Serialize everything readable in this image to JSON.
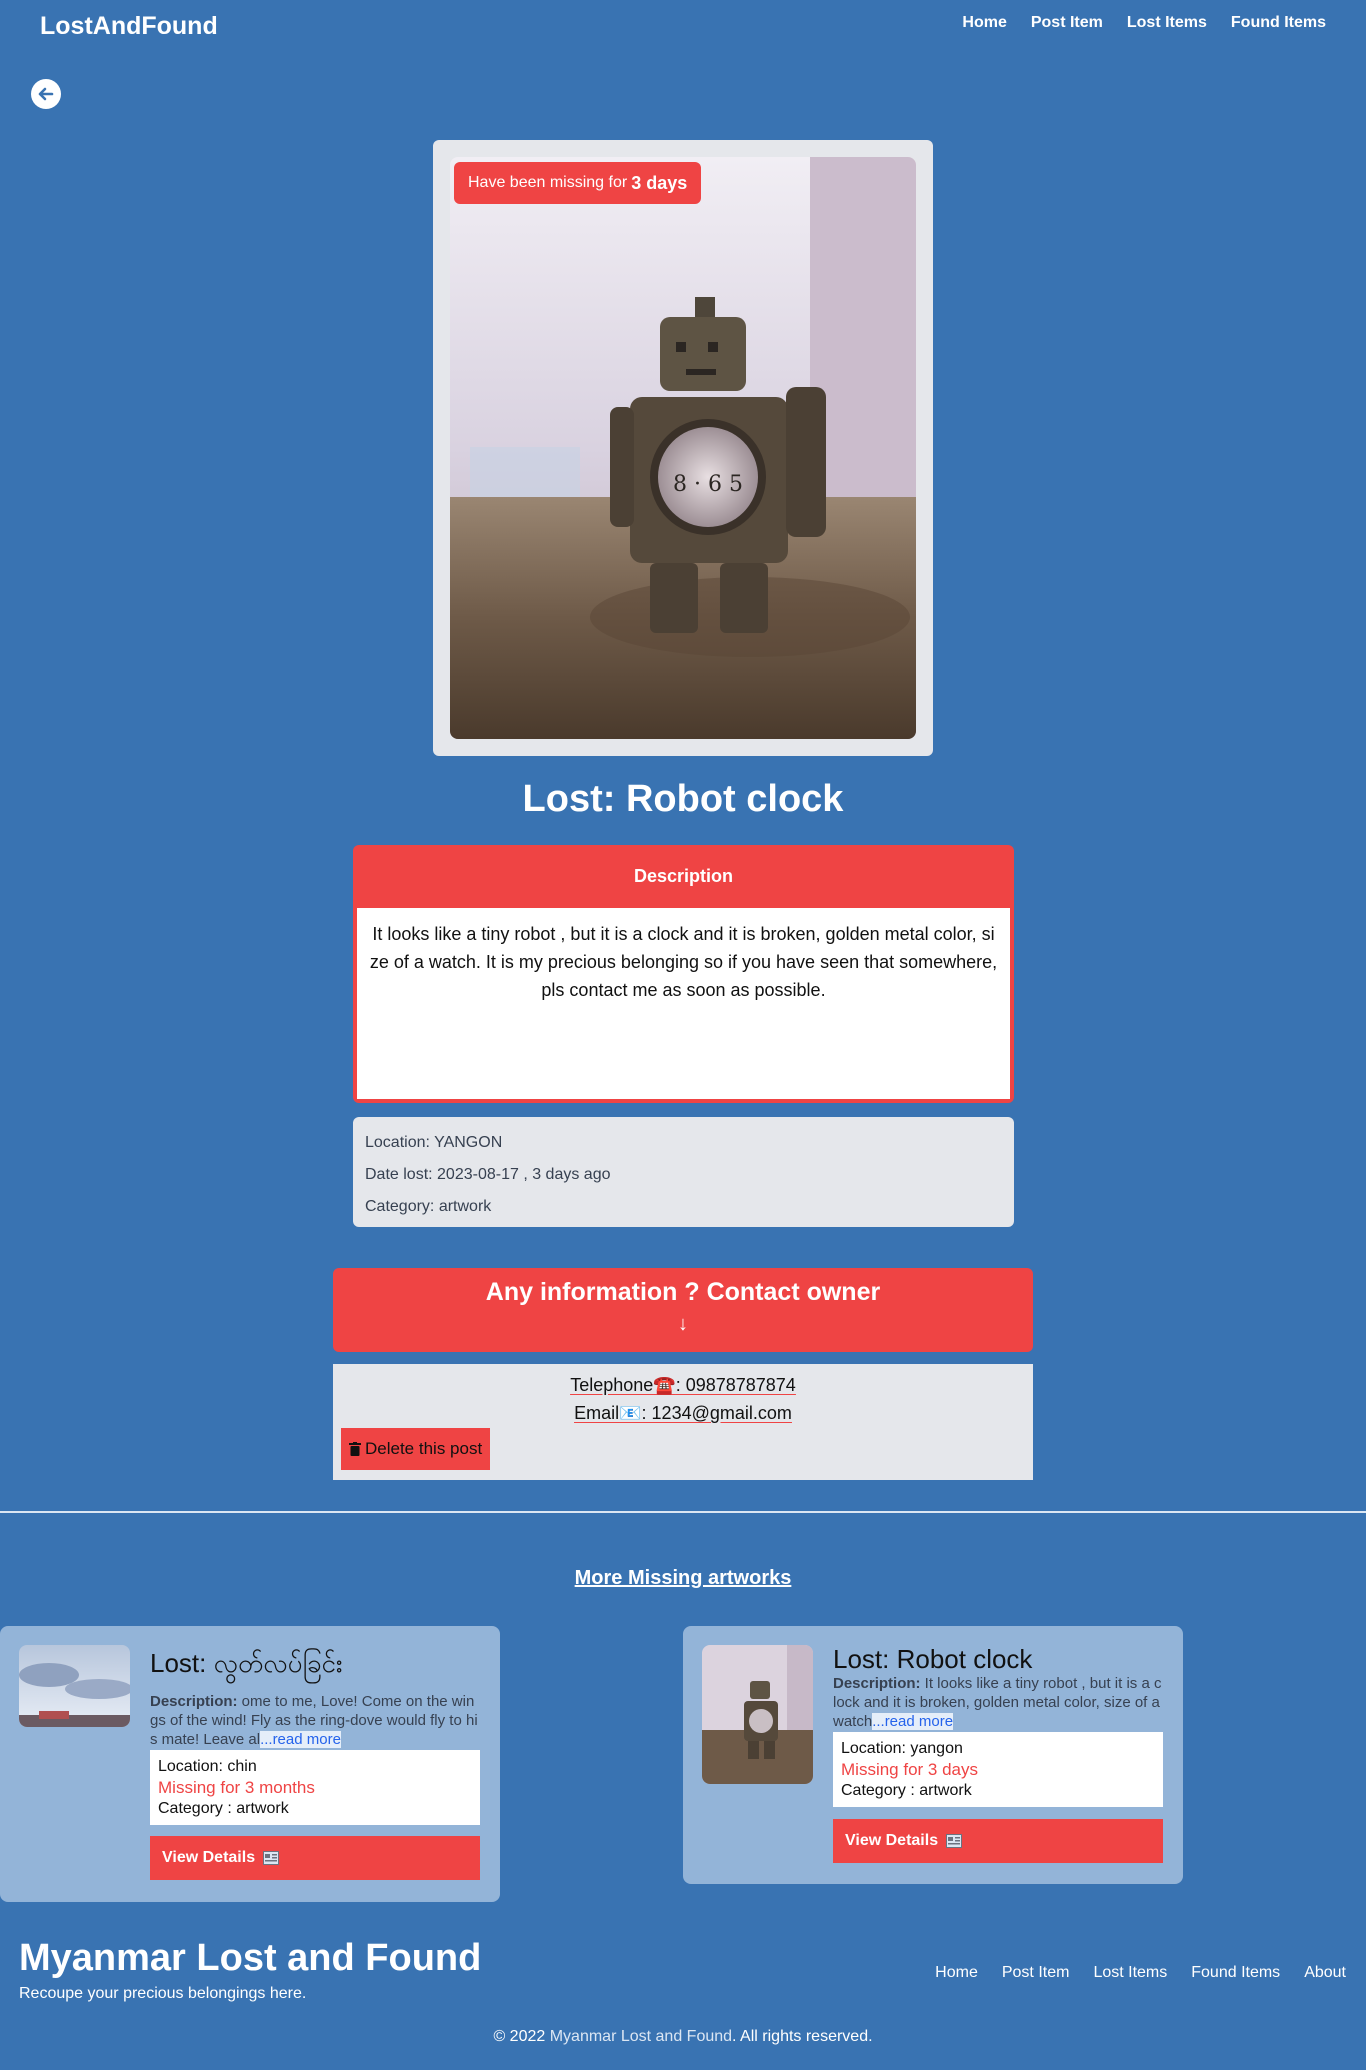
{
  "nav": {
    "brand": "LostAndFound",
    "links": [
      "Home",
      "Post Item",
      "Lost Items",
      "Found Items"
    ]
  },
  "badge": {
    "prefix": "Have been missing for",
    "duration": "3 days"
  },
  "item": {
    "title": "Lost: Robot clock",
    "description_header": "Description",
    "description": "It looks like a tiny robot , but it is a clock and it is broken, golden metal color, size of a watch. It is my precious belonging so if you have seen that somewhere, pls contact me as soon as possible.",
    "location": "Location: YANGON",
    "date_lost": "Date lost: 2023-08-17 , 3 days ago",
    "category": "Category: artwork"
  },
  "contact": {
    "title": "Any information ? Contact owner",
    "arrow": "↓",
    "telephone_label": "Telephone",
    "telephone_icon": "☎️",
    "telephone": ": 09878787874",
    "email_label": "Email",
    "email_icon": "📧",
    "email": ": 1234@gmail.com",
    "delete_label": "Delete this post"
  },
  "more": {
    "title": "More Missing artworks",
    "cards": [
      {
        "title": "Lost: လွတ်လပ်ခြင်း",
        "desc_label": "Description:",
        "desc": " ome to me, Love! Come on the wings of the wind! Fly as the ring-dove would fly to his mate! Leave al",
        "read_more": "...read more",
        "location": "Location: chin",
        "missing": "Missing for 3 months",
        "category": "Category : artwork",
        "button": "View Details"
      },
      {
        "title": "Lost: Robot clock",
        "desc_label": "Description:",
        "desc": " It looks like a tiny robot , but it is a clock and it is broken, golden metal color, size of a watch",
        "read_more": "...read more",
        "location": "Location: yangon",
        "missing": "Missing for 3 days",
        "category": "Category : artwork",
        "button": "View Details"
      }
    ]
  },
  "footer": {
    "title": "Myanmar Lost and Found",
    "tagline": "Recoupe your precious belongings here.",
    "links": [
      "Home",
      "Post Item",
      "Lost Items",
      "Found Items",
      "About"
    ],
    "copyright_prefix": "© 2022",
    "copyright_org": "Myanmar Lost and Found",
    "copyright_suffix": ". All rights reserved."
  },
  "colors": {
    "background": "#3973b2",
    "accent": "#ef4444",
    "panel": "#e5e7eb",
    "card": "#93b4d8"
  }
}
